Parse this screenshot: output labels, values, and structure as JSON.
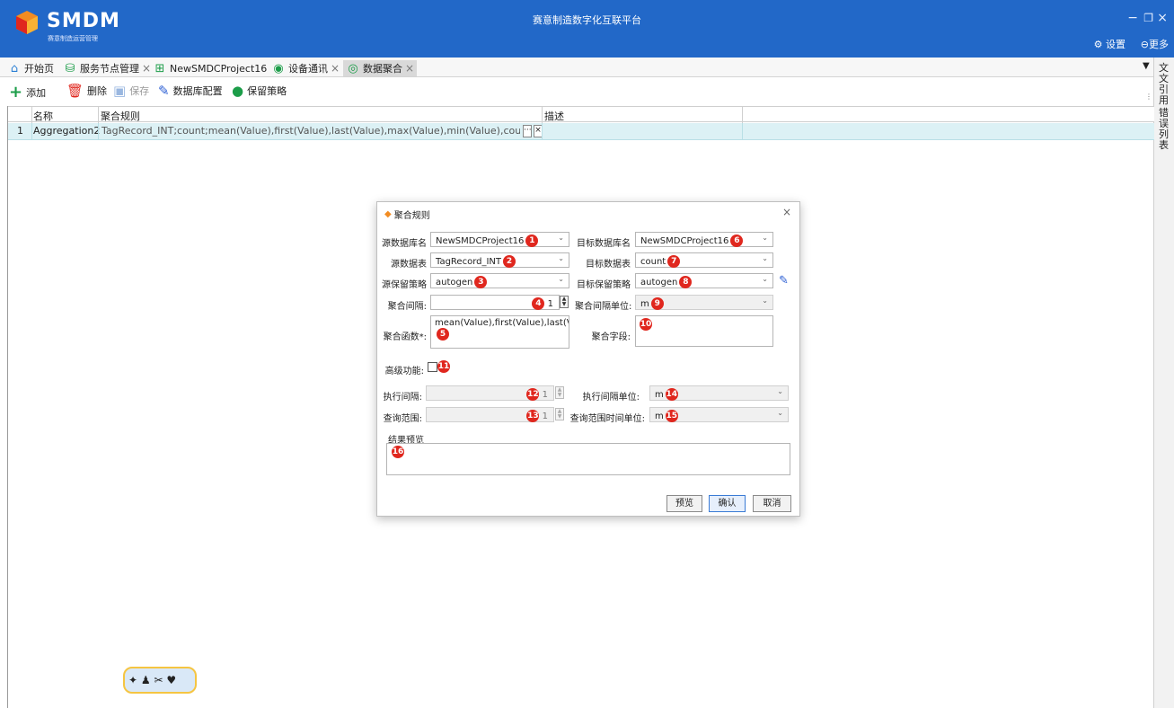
{
  "app": {
    "logo_text": "SMDM",
    "logo_sub": "赛意制造运营管理",
    "title": "赛意制造数字化互联平台",
    "settings_label": "设置",
    "more_label": "更多"
  },
  "tabs": [
    {
      "label": "开始页",
      "icon": "home-icon"
    },
    {
      "label": "服务节点管理",
      "icon": "service-node-icon"
    },
    {
      "label": "NewSMDCProject16",
      "icon": "grid-project-icon"
    },
    {
      "label": "设备通讯",
      "icon": "antenna-icon"
    },
    {
      "label": "数据聚合",
      "icon": "aggregate-icon"
    }
  ],
  "side_panel": {
    "item1": "文文引用",
    "item2": "错误列表"
  },
  "toolbar": {
    "add": "添加",
    "delete": "删除",
    "save": "保存",
    "db_config": "数据库配置",
    "retention": "保留策略"
  },
  "grid": {
    "columns": [
      "名称",
      "聚合规则",
      "描述"
    ],
    "rows": [
      {
        "index": "1",
        "name": "Aggregation2",
        "rule": "TagRecord_INT;count;mean(Value),first(Value),last(Value),max(Value),min(Value),count(Value);",
        "ellipsis": "···",
        "clear": "×",
        "desc": ""
      }
    ]
  },
  "dialog": {
    "title": "聚合规则",
    "labels": {
      "src_db": "源数据库名",
      "src_table": "源数据表",
      "src_policy": "源保留策略",
      "agg_interval": "聚合间隔:",
      "agg_func": "聚合函数*:",
      "dst_db": "目标数据库名",
      "dst_table": "目标数据表",
      "dst_policy": "目标保留策略",
      "agg_unit": "聚合间隔单位:",
      "agg_field": "聚合字段:",
      "advanced": "高级功能:",
      "exec_interval": "执行间隔:",
      "exec_unit": "执行间隔单位:",
      "query_range": "查询范围:",
      "query_unit": "查询范围时间单位:",
      "preview_label": "结果预览"
    },
    "values": {
      "src_db": "NewSMDCProject16",
      "src_table": "TagRecord_INT",
      "src_policy": "autogen",
      "agg_interval": "1",
      "agg_func": "mean(Value),first(Value),last(Value),max(Value),min(Value),count(Value)",
      "dst_db": "NewSMDCProject16",
      "dst_table": "count",
      "dst_policy": "autogen",
      "agg_unit": "m",
      "agg_field": "",
      "exec_interval": "1",
      "exec_unit": "m",
      "query_range": "1",
      "query_unit": "m"
    },
    "badges": [
      "1",
      "2",
      "3",
      "4",
      "5",
      "6",
      "7",
      "8",
      "9",
      "10",
      "11",
      "12",
      "13",
      "14",
      "15",
      "16"
    ],
    "buttons": {
      "preview": "预览",
      "ok": "确认",
      "cancel": "取消"
    }
  },
  "colors": {
    "titlebar": "#2268c8",
    "badge": "#e0271e",
    "row_highlight": "#dcf1f5"
  }
}
